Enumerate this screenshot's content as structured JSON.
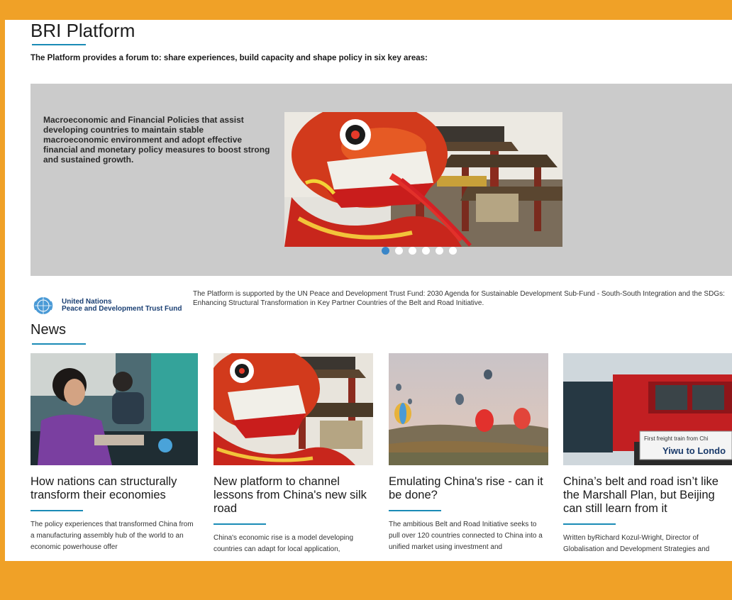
{
  "page": {
    "title": "BRI Platform",
    "intro": "The Platform provides a forum to: share experiences, build capacity and shape policy in six key areas:"
  },
  "carousel": {
    "slide_text": "Macroeconomic and Financial Policies that assist developing countries to maintain stable macroeconomic environment and adopt effective financial and monetary policy measures to boost strong and sustained growth.",
    "slide_count": 6,
    "active_index": 0
  },
  "partner": {
    "org_line1": "United Nations",
    "org_line2": "Peace and Development Trust Fund",
    "support_text": "The Platform is supported by the UN Peace and Development Trust Fund: 2030 Agenda for Sustainable Development Sub-Fund - South-South Integration and the SDGs: Enhancing Structural Transformation in Key Partner Countries of the Belt and Road Initiative."
  },
  "news": {
    "heading": "News",
    "items": [
      {
        "title": "How nations can structurally transform their economies",
        "excerpt": "The policy experiences that transformed China from a manufacturing assembly hub of the world to an economic powerhouse offer"
      },
      {
        "title": "New platform to channel lessons from China's new silk road",
        "excerpt": "China's economic rise is a model developing countries can adapt for local application,"
      },
      {
        "title": "Emulating China's rise - can it be done?",
        "excerpt": "The ambitious Belt and Road Initiative seeks to pull over 120 countries connected to China into a unified market using investment and"
      },
      {
        "title": "China’s belt and road isn’t like the Marshall Plan, but Beijing can still learn from it",
        "excerpt": "Written byRichard Kozul-Wright, Director of Globalisation and Development Strategies and",
        "image_caption_1": "First freight train from Chi",
        "image_caption_2": "Yiwu to Londo"
      }
    ]
  },
  "colors": {
    "frame": "#f0a127",
    "accent": "#1a8bb6",
    "carousel_bg": "#cbcbcb",
    "dot_active": "#3a86c8"
  }
}
